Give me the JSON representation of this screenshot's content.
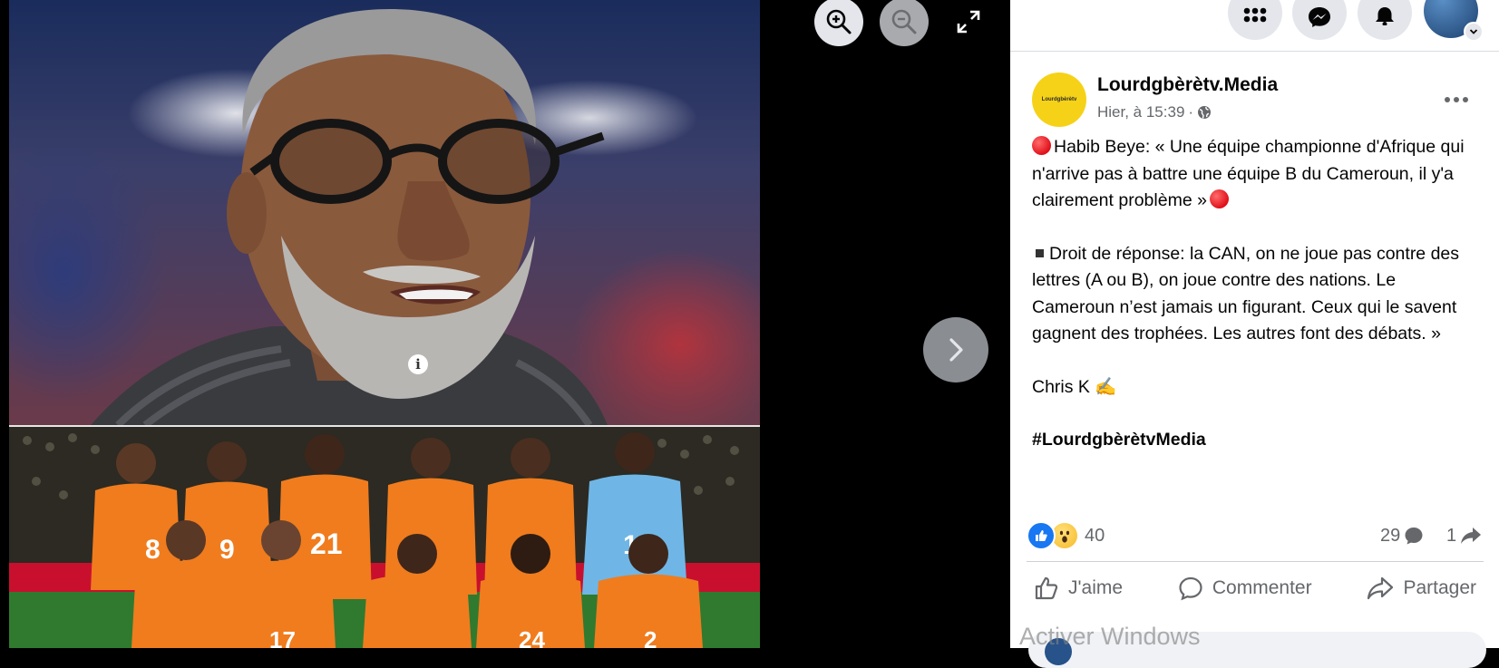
{
  "viewer": {
    "zoom_in_icon": "zoom-in-icon",
    "zoom_out_icon": "zoom-out-icon",
    "fullscreen_icon": "fullscreen-icon",
    "next_icon": "chevron-right-icon",
    "info_glyph": "i",
    "jersey_numbers": [
      "8",
      "9",
      "21",
      "1",
      "17",
      "24",
      "2"
    ]
  },
  "topbar": {
    "menu_icon": "grid-menu-icon",
    "messenger_icon": "messenger-icon",
    "notifications_icon": "bell-icon",
    "profile_icon": "profile-avatar",
    "badge_color": "#e41e3f"
  },
  "post": {
    "page_name": "Lourdgbèrètv.Media",
    "avatar_text": "Lourdgbèrètv",
    "timestamp": "Hier, à 15:39",
    "separator": "·",
    "audience_icon": "globe-icon",
    "paragraph1": "Habib Beye: « Une équipe championne d'Afrique qui n'arrive pas à battre une équipe B du Cameroun, il y'a clairement problème »",
    "paragraph2": "Droit de réponse: la CAN, on ne joue pas contre des lettres (A ou B), on joue contre des nations. Le Cameroun n’est jamais un figurant. Ceux qui le savent gagnent des trophées. Les autres font des débats. »",
    "signature": "Chris K ✍️",
    "hashtag": "#LourdgbèrètvMedia",
    "reaction_count": "40",
    "comment_count": "29",
    "share_count": "1",
    "actions": {
      "like": "J'aime",
      "comment": "Commenter",
      "share": "Partager"
    }
  },
  "watermark": "Activer Windows",
  "colors": {
    "facebook_blue": "#1877f2",
    "secondary_text": "#65676b",
    "avatar_yellow": "#f5d218",
    "jersey_orange": "#f07c1e",
    "keeper_blue": "#6fb6e6"
  }
}
